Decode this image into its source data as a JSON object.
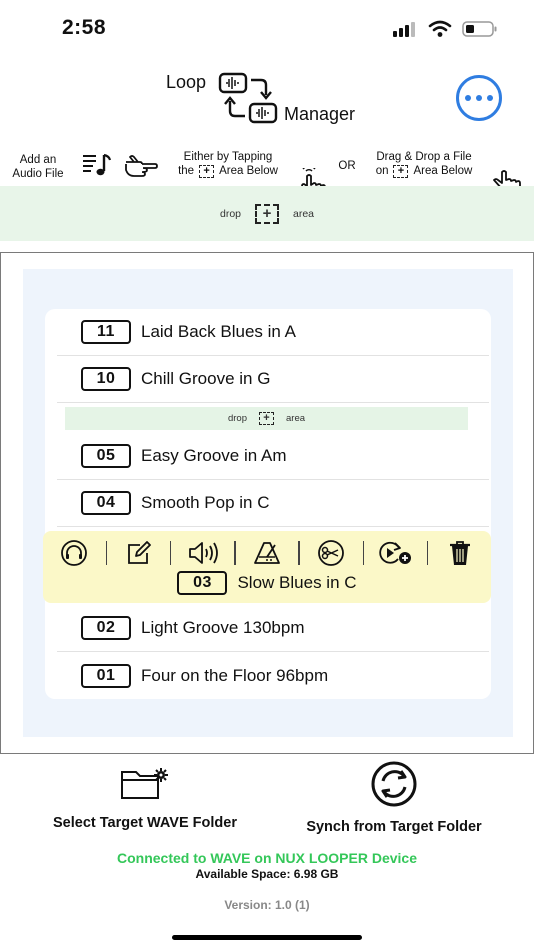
{
  "status": {
    "time": "2:58"
  },
  "app": {
    "title_part1": "Loop",
    "title_part2": "Manager"
  },
  "instructions": {
    "add_line1": "Add an",
    "add_line2": "Audio File",
    "tap_line1": "Either by Tapping",
    "tap_line2a": "the",
    "tap_line2b": "Area Below",
    "or": "OR",
    "drag_line1": "Drag & Drop a File",
    "drag_line2a": "on",
    "drag_line2b": "Area Below"
  },
  "drop_area": {
    "left": "drop",
    "right": "area"
  },
  "loops": [
    {
      "num": "11",
      "title": "Laid Back Blues in A"
    },
    {
      "num": "10",
      "title": "Chill Groove in G"
    },
    {
      "num": "05",
      "title": "Easy Groove in Am"
    },
    {
      "num": "04",
      "title": "Smooth Pop in C"
    },
    {
      "num": "03",
      "title": "Slow Blues in C"
    },
    {
      "num": "02",
      "title": "Light Groove 130bpm"
    },
    {
      "num": "01",
      "title": "Four on the Floor 96bpm"
    }
  ],
  "actions": {
    "select_folder": "Select Target WAVE Folder",
    "synch": "Synch from Target Folder"
  },
  "connection": {
    "status": "Connected to WAVE on NUX LOOPER Device",
    "space": "Available Space: 6.98 GB"
  },
  "version": "Version: 1.0 (1)",
  "colors": {
    "accent_blue": "#2f7de1",
    "connected_green": "#34c759",
    "selected_yellow": "#fbf8c8",
    "drop_green": "#e8f5e9"
  }
}
